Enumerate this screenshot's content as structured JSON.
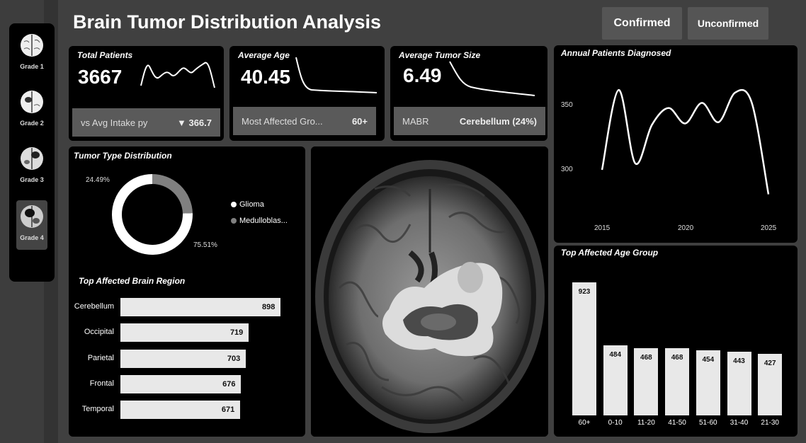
{
  "title": "Brain Tumor Distribution Analysis",
  "toggles": {
    "confirmed": "Confirmed",
    "unconfirmed": "Unconfirmed"
  },
  "grades": [
    {
      "label": "Grade 1",
      "active": false
    },
    {
      "label": "Grade 2",
      "active": false
    },
    {
      "label": "Grade 3",
      "active": false
    },
    {
      "label": "Grade 4",
      "active": true
    }
  ],
  "kpis": {
    "total_patients": {
      "title": "Total Patients",
      "value": "3667",
      "footer_label": "vs Avg Intake py",
      "footer_value": "▼ 366.7"
    },
    "average_age": {
      "title": "Average Age",
      "value": "40.45",
      "footer_label": "Most Affected Gro...",
      "footer_value": "60+"
    },
    "average_tumor_size": {
      "title": "Average Tumor Size",
      "value": "6.49",
      "footer_label": "MABR",
      "footer_value": "Cerebellum (24%)"
    }
  },
  "tumor_type": {
    "title": "Tumor Type Distribution",
    "legend": [
      "Glioma",
      "Medulloblas..."
    ],
    "label_small": "24.49%",
    "label_large": "75.51%"
  },
  "brain_region": {
    "title": "Top Affected Brain Region"
  },
  "annual": {
    "title": "Annual Patients Diagnosed",
    "y_ticks": [
      "350",
      "300"
    ],
    "x_ticks": [
      "2015",
      "2020",
      "2025"
    ]
  },
  "age_group": {
    "title": "Top Affected Age Group"
  },
  "colors": {
    "card": "#000000",
    "accent_bar": "#e8e8e8",
    "secondary": "#808080",
    "bg": "#404040"
  },
  "chart_data": [
    {
      "type": "pie",
      "title": "Tumor Type Distribution",
      "categories": [
        "Glioma",
        "Medulloblas..."
      ],
      "values": [
        75.51,
        24.49
      ]
    },
    {
      "type": "bar",
      "title": "Top Affected Brain Region",
      "categories": [
        "Cerebellum",
        "Occipital",
        "Parietal",
        "Frontal",
        "Temporal"
      ],
      "values": [
        898,
        719,
        703,
        676,
        671
      ]
    },
    {
      "type": "line",
      "title": "Annual Patients Diagnosed",
      "x": [
        2015,
        2016,
        2017,
        2018,
        2019,
        2020,
        2021,
        2022,
        2023,
        2024,
        2025
      ],
      "values": [
        300,
        362,
        305,
        335,
        348,
        336,
        352,
        337,
        360,
        352,
        281
      ],
      "ylim": [
        270,
        380
      ]
    },
    {
      "type": "bar",
      "title": "Top Affected Age Group",
      "categories": [
        "60+",
        "0-10",
        "11-20",
        "41-50",
        "51-60",
        "31-40",
        "21-30"
      ],
      "values": [
        923,
        484,
        468,
        468,
        454,
        443,
        427
      ]
    }
  ]
}
